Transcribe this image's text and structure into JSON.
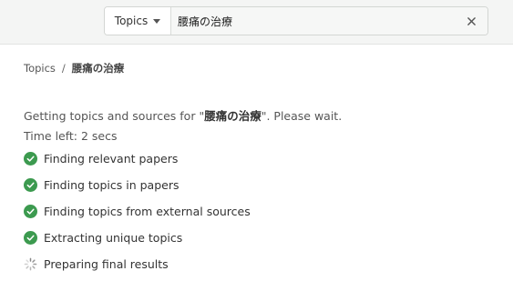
{
  "search": {
    "scope_label": "Topics",
    "query": "腰痛の治療",
    "clear_icon": "close-icon"
  },
  "breadcrumb": {
    "root": "Topics",
    "separator": "/",
    "current": "腰痛の治療"
  },
  "status": {
    "prefix": "Getting topics and sources for \"",
    "query": "腰痛の治療",
    "suffix": "\". Please wait.",
    "time_left": "Time left: 2 secs"
  },
  "steps": [
    {
      "label": "Finding relevant papers",
      "state": "done",
      "icon": "check-circle-icon"
    },
    {
      "label": "Finding topics in papers",
      "state": "done",
      "icon": "check-circle-icon"
    },
    {
      "label": "Finding topics from external sources",
      "state": "done",
      "icon": "check-circle-icon"
    },
    {
      "label": "Extracting unique topics",
      "state": "done",
      "icon": "check-circle-icon"
    },
    {
      "label": "Preparing final results",
      "state": "loading",
      "icon": "spinner-icon"
    }
  ],
  "colors": {
    "check": "#3c9a4f",
    "topbar": "#f4f5f4",
    "spinner": "#888888"
  }
}
